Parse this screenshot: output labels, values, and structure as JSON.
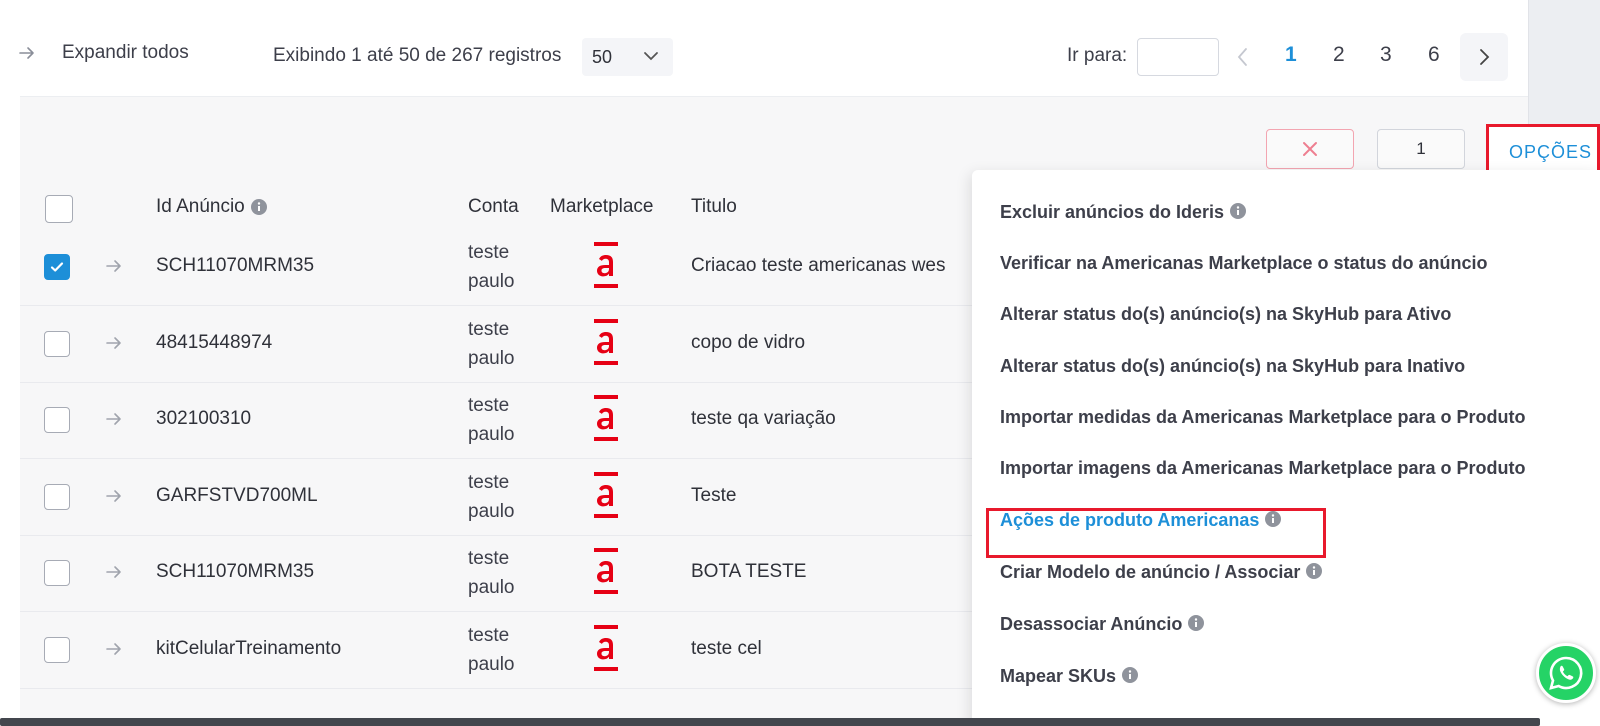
{
  "toolbar": {
    "expand_label": "Expandir todos",
    "showing_text": "Exibindo 1 até 50 de 267 registros",
    "per_page": "50",
    "goto_label": "Ir para:",
    "goto_value": "",
    "pages": [
      "1",
      "2",
      "3",
      "6"
    ],
    "active_page": "1"
  },
  "actions": {
    "clear_icon": "close-icon",
    "selected_count": "1",
    "options_label": "OPÇÕES"
  },
  "table": {
    "headers": {
      "id": "Id Anúncio",
      "account": "Conta",
      "marketplace": "Marketplace",
      "title": "Titulo"
    },
    "rows": [
      {
        "checked": true,
        "id": "SCH11070MRM35",
        "account": "teste paulo",
        "marketplace_logo": "americanas-logo",
        "title": "Criacao teste americanas wes"
      },
      {
        "checked": false,
        "id": "48415448974",
        "account": "teste paulo",
        "marketplace_logo": "americanas-logo",
        "title": "copo de vidro"
      },
      {
        "checked": false,
        "id": "302100310",
        "account": "teste paulo",
        "marketplace_logo": "americanas-logo",
        "title": "teste qa variação"
      },
      {
        "checked": false,
        "id": "GARFSTVD700ML",
        "account": "teste paulo",
        "marketplace_logo": "americanas-logo",
        "title": "Teste"
      },
      {
        "checked": false,
        "id": "SCH11070MRM35",
        "account": "teste paulo",
        "marketplace_logo": "americanas-logo",
        "title": "BOTA TESTE"
      },
      {
        "checked": false,
        "id": "kitCelularTreinamento",
        "account": "teste paulo",
        "marketplace_logo": "americanas-logo",
        "title": "teste cel"
      }
    ]
  },
  "menu": {
    "items": [
      {
        "label": "Excluir anúncios do Ideris",
        "info": true
      },
      {
        "label": "Verificar na Americanas Marketplace o status do anúncio",
        "info": false
      },
      {
        "label": "Alterar status do(s) anúncio(s) na SkyHub para Ativo",
        "info": false
      },
      {
        "label": "Alterar status do(s) anúncio(s) na SkyHub para Inativo",
        "info": false
      },
      {
        "label": "Importar medidas da Americanas Marketplace para o Produto",
        "info": false
      },
      {
        "label": "Importar imagens da Americanas Marketplace para o Produto",
        "info": false
      },
      {
        "label": "Ações de produto Americanas",
        "info": true,
        "highlighted": true
      },
      {
        "label": "Criar Modelo de anúncio / Associar",
        "info": true
      },
      {
        "label": "Desassociar Anúncio",
        "info": true
      },
      {
        "label": "Mapear SKUs",
        "info": true
      }
    ]
  },
  "colors": {
    "accent": "#1d8fd8",
    "highlight_border": "#e8192c",
    "americanas_red": "#e60014",
    "whatsapp": "#25d366"
  },
  "whatsapp_icon": "whatsapp-icon"
}
